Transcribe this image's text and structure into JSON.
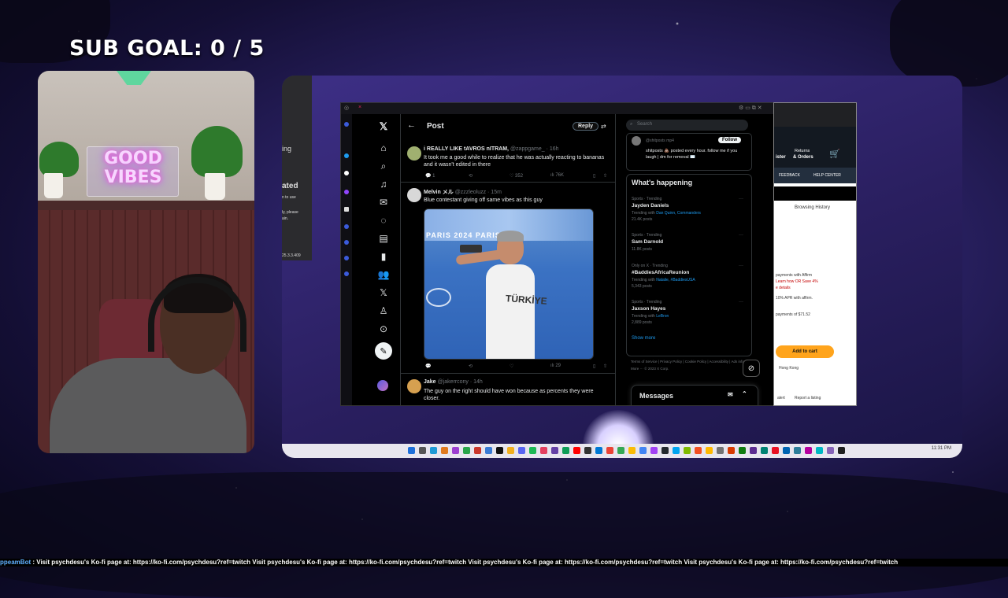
{
  "overlay": {
    "sub_goal": "SUB GOAL:  0 / 5",
    "webcam_sign": "GOOD VIBES",
    "ticker_bot": "ppeamBot",
    "ticker_text": "Visit psychdesu's Ko-fi page at: https://ko-fi.com/psychdesu?ref=twitch  Visit psychdesu's Ko-fi page at: https://ko-fi.com/psychdesu?ref=twitch  Visit psychdesu's Ko-fi page at: https://ko-fi.com/psychdesu?ref=twitch  Visit psychdesu's Ko-fi page at: https://ko-fi.com/psychdesu?ref=twitch"
  },
  "left_app": {
    "line1": "ated",
    "line2": "n to use",
    "line3": "ly, please",
    "line4": "ain.",
    "version": "25.3.3.409",
    "tab": "ing"
  },
  "x": {
    "header_title": "Post",
    "reply_button": "Reply",
    "tweets": [
      {
        "name": "i REALLY LIKE tAVROS nITRAM,",
        "meta": "@zappgame_ · 16h",
        "text": "It took me a good while to realize that he was actually reacting to bananas and it wasn't edited in there",
        "replies": "1",
        "likes": "352",
        "views": "76K"
      },
      {
        "name": "Melvin メル",
        "meta": "@zzzleoluzz · 15m",
        "text": "Blue contestant giving off same vibes as this guy",
        "views": "29",
        "media_banner": "PARIS 2024     PARIS 2024",
        "media_shirt": "TÜRKİYE"
      },
      {
        "name": "Jake",
        "meta": "@jakerrcony · 14h",
        "text": "The guy on the right should have won because as percents they were closer."
      }
    ],
    "sidebar": {
      "search_placeholder": "Search",
      "follow_handle": "@shitposts mp4",
      "follow_button": "Follow",
      "follow_bio": "shitposts 💩 posted every hour. follow me if you laugh | dm for removal ✉️",
      "trends_title": "What's happening",
      "trends": [
        {
          "context": "Sports · Trending",
          "name": "Jayden Daniels",
          "trending_with": "Trending with ",
          "links": "Dan Quinn, Commanders",
          "count": "21.4K posts"
        },
        {
          "context": "Sports · Trending",
          "name": "Sam Darnold",
          "trending_with": "",
          "links": "",
          "count": "11.8K posts"
        },
        {
          "context": "Only on X · Trending",
          "name": "#BaddiesAfricaReunion",
          "trending_with": "Trending with ",
          "links": "Natalie, #BaddiesUSA",
          "count": "5,343 posts"
        },
        {
          "context": "Sports · Trending",
          "name": "Jaxson Hayes",
          "trending_with": "Trending with ",
          "links": "LeBron",
          "count": "2,889 posts"
        }
      ],
      "show_more": "Show more",
      "footer": "Terms of Service  |  Privacy Policy  |  Cookie Policy  |  Accessibility  |  Ads info  |  More ···  © 2023 X Corp.",
      "messages": "Messages"
    }
  },
  "amazon": {
    "returns": "Returns",
    "orders": "& Orders",
    "register": "ister",
    "feedback": "FEEDBACK",
    "help_center": "HELP CENTER",
    "browsing_history": "Browsing History",
    "pay_line1": "payments with Affirm",
    "pay_line2": "Learn how OR Save 4%",
    "pay_line3": "e details",
    "apr": "10% APR with affirm.",
    "payments": "payments of $71.52",
    "add_to_cart": "Add to cart",
    "ships_from": "Hong Kong",
    "report": "Report a listing",
    "alert": "alert"
  },
  "taskbar": {
    "time": "11:31 PM"
  }
}
